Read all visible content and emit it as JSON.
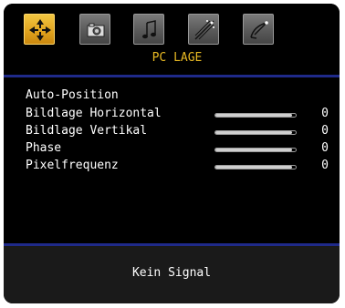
{
  "menu": {
    "title": "PC LAGE",
    "tabs": [
      {
        "icon": "pc-position-icon",
        "active": true
      },
      {
        "icon": "camera-icon",
        "active": false
      },
      {
        "icon": "music-note-icon",
        "active": false
      },
      {
        "icon": "feature-star-icon",
        "active": false
      },
      {
        "icon": "satellite-icon",
        "active": false
      }
    ],
    "items": [
      {
        "label": "Auto-Position",
        "has_slider": false
      },
      {
        "label": "Bildlage Horizontal",
        "has_slider": true,
        "value": "0",
        "level": 0.0
      },
      {
        "label": "Bildlage Vertikal",
        "has_slider": true,
        "value": "0",
        "level": 0.0
      },
      {
        "label": "Phase",
        "has_slider": true,
        "value": "0",
        "level": 0.0
      },
      {
        "label": "Pixelfrequenz",
        "has_slider": true,
        "value": "0",
        "level": 0.0
      }
    ]
  },
  "status": {
    "text": "Kein Signal"
  },
  "colors": {
    "background": "#000000",
    "accent": "#e8b923",
    "divider": "#1f2a8a",
    "status_bar": "#1a1a1a",
    "text": "#ffffff"
  }
}
